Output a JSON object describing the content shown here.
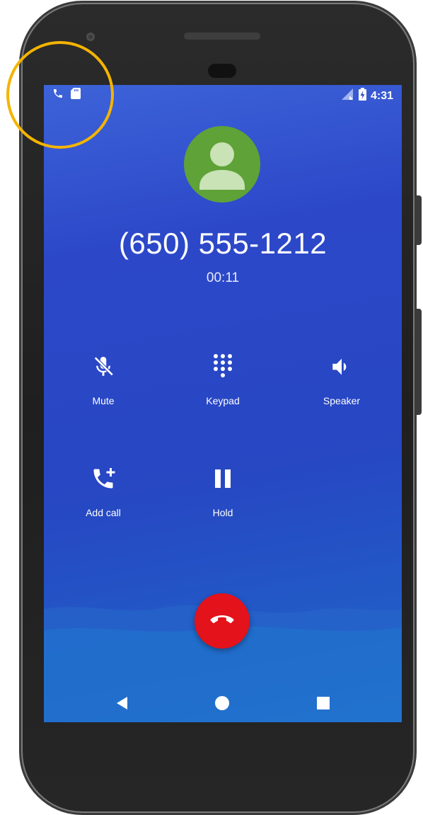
{
  "status_bar": {
    "time": "4:31",
    "left_icons": [
      "phone-call-icon",
      "sd-card-icon"
    ],
    "right_icons": [
      "signal-no-data-icon",
      "battery-charging-icon"
    ]
  },
  "call": {
    "number": "(650) 555-1212",
    "duration": "00:11"
  },
  "actions": {
    "mute": {
      "label": "Mute",
      "icon": "mic-off-icon"
    },
    "keypad": {
      "label": "Keypad",
      "icon": "dialpad-icon"
    },
    "speaker": {
      "label": "Speaker",
      "icon": "volume-icon"
    },
    "add_call": {
      "label": "Add call",
      "icon": "add-call-icon"
    },
    "hold": {
      "label": "Hold",
      "icon": "pause-icon"
    }
  },
  "end_call": {
    "icon": "end-call-icon",
    "color": "#e3121b"
  },
  "nav": {
    "back": "back-icon",
    "home": "home-icon",
    "recents": "recents-icon"
  },
  "colors": {
    "screen_top": "#3d63d8",
    "screen_bottom": "#1e78d0",
    "avatar": "#5fa237",
    "highlight": "#f4b400"
  }
}
